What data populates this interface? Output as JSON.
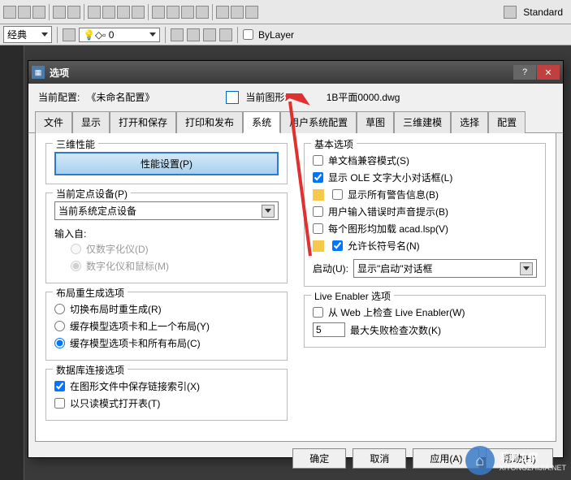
{
  "top_toolbar": {
    "standard_label": "Standard",
    "bylayer_label": "ByLayer",
    "style_label": "经典"
  },
  "dialog": {
    "title": "选项",
    "config_row": {
      "label": "当前配置:",
      "value": "《未命名配置》",
      "drawing_label": "当前图形:",
      "drawing_value": "1B平面0000.dwg"
    },
    "tabs": [
      "文件",
      "显示",
      "打开和保存",
      "打印和发布",
      "系统",
      "用户系统配置",
      "草图",
      "三维建模",
      "选择",
      "配置"
    ],
    "active_tab_index": 4,
    "left": {
      "perf": {
        "legend": "三维性能",
        "button": "性能设置(P)"
      },
      "pointer": {
        "legend": "当前定点设备(P)",
        "combo": "当前系统定点设备",
        "input_from": "输入自:",
        "r1": "仅数字化仪(D)",
        "r2": "数字化仪和鼠标(M)"
      },
      "layout": {
        "legend": "布局重生成选项",
        "r1": "切换布局时重生成(R)",
        "r2": "缓存模型选项卡和上一个布局(Y)",
        "r3": "缓存模型选项卡和所有布局(C)"
      },
      "db": {
        "legend": "数据库连接选项",
        "c1": "在图形文件中保存链接索引(X)",
        "c2": "以只读模式打开表(T)"
      }
    },
    "right": {
      "basic": {
        "legend": "基本选项",
        "c1": "单文档兼容模式(S)",
        "c2": "显示 OLE 文字大小对话框(L)",
        "c3": "显示所有警告信息(B)",
        "c4": "用户输入错误时声音提示(B)",
        "c5": "每个图形均加载 acad.lsp(V)",
        "c6": "允许长符号名(N)",
        "start_label": "启动(U):",
        "start_combo": "显示\"启动\"对话框"
      },
      "live": {
        "legend": "Live Enabler 选项",
        "c1": "从 Web 上检查 Live Enabler(W)",
        "num": "5",
        "num_label": "最大失败检查次数(K)"
      }
    },
    "buttons": {
      "ok": "确定",
      "cancel": "取消",
      "apply": "应用(A)",
      "help": "帮助(H)"
    }
  },
  "watermark": {
    "text": "系统之家",
    "url": "XITONGZHIJIA.NET"
  }
}
